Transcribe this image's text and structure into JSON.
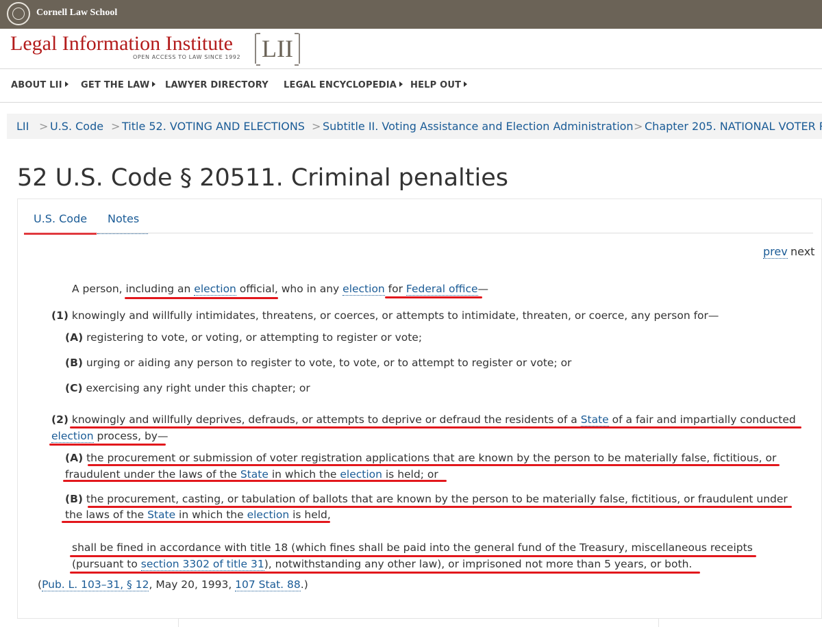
{
  "topbar": {
    "school": "Cornell Law School"
  },
  "header": {
    "title": "Legal Information Institute",
    "tagline": "OPEN ACCESS TO LAW SINCE 1992",
    "logo_box": "LII"
  },
  "nav": {
    "items": [
      "ABOUT LII",
      "GET THE LAW",
      "LAWYER DIRECTORY",
      "LEGAL ENCYCLOPEDIA",
      "HELP OUT"
    ]
  },
  "breadcrumb": {
    "items": [
      "LII",
      "U.S. Code",
      "Title 52. VOTING AND ELECTIONS",
      "Subtitle II. Voting Assistance and Election Administration",
      "Chapter 205. NATIONAL VOTER R"
    ],
    "sep": ">"
  },
  "heading": "52 U.S. Code § 20511. Criminal penalties",
  "tabs": [
    "U.S. Code",
    "Notes"
  ],
  "pager": {
    "prev": "prev",
    "next": "next"
  },
  "text": {
    "intro": {
      "a": "A person, including an ",
      "link1": "election",
      "b": " official, who in any ",
      "link2": "election",
      "c": " for ",
      "link3": "Federal office",
      "d": "—"
    },
    "p1": {
      "label": "(1)",
      "text": " knowingly and willfully intimidates, threatens, or coerces, or attempts to intimidate, threaten, or coerce, any person for—"
    },
    "p1A": {
      "label": "(A)",
      "text": " registering to vote, or voting, or attempting to register or vote;"
    },
    "p1B": {
      "label": "(B)",
      "text": " urging or aiding any person to register to vote, to vote, or to attempt to register or vote; or"
    },
    "p1C": {
      "label": "(C)",
      "text": " exercising any right under this chapter; or"
    },
    "p2": {
      "label": "(2)",
      "a": " knowingly and willfully deprives, defrauds, or attempts to deprive or defraud the residents of a ",
      "link1": "State",
      "b": " of a fair and impartially conducted",
      "link2": "election",
      "c": " process, by—"
    },
    "p2A": {
      "label": "(A)",
      "a": " the procurement or submission of voter registration applications that are known by the person to be materially false, fictitious, or",
      "b": "fraudulent under the laws of the ",
      "link1": "State",
      "c": " in which the ",
      "link2": "election",
      "d": " is held; or"
    },
    "p2B": {
      "label": "(B)",
      "a": " the procurement, casting, or tabulation of ballots that are known by the person to be materially false, fictitious, or fraudulent under",
      "b": "the laws of the ",
      "link1": "State",
      "c": " in which the ",
      "link2": "election",
      "d": " is held,"
    },
    "closing": {
      "a": "shall be fined in accordance with title 18 (which fines shall be paid into the general fund of the Treasury, miscellaneous receipts",
      "b": "(pursuant to ",
      "link1": "section 3302 of title 31",
      "c": "), notwithstanding any other law), or imprisoned not more than 5 years, or both."
    },
    "source": {
      "a": "(",
      "link1": "Pub. L. 103–31, § 12",
      "b": ", May 20, 1993, ",
      "link2": "107 Stat. 88",
      "c": ".)"
    }
  },
  "colors": {
    "topbar": "#6b6357",
    "brand_red": "#b31b1b",
    "link": "#1a5b96",
    "annotation_red": "#e2171c"
  }
}
